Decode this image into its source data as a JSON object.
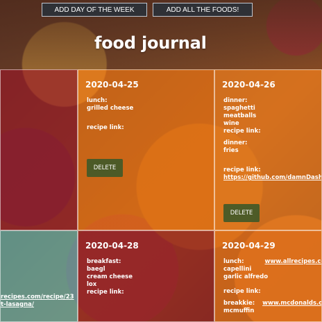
{
  "buttons": {
    "add_day": "ADD DAY OF THE WEEK",
    "add_foods": "ADD ALL THE FOODS!"
  },
  "page": {
    "title": "food journal"
  },
  "cards": {
    "left_top": {
      "links": []
    },
    "card_2020_04_25": {
      "date": "2020-04-25",
      "lines": [
        "lunch:",
        "grilled cheese",
        "recipe link:"
      ],
      "delete_label": "DELETE"
    },
    "card_2020_04_26": {
      "date": "2020-04-26",
      "lines": [
        "dinner:",
        "spaghetti",
        "meatballs",
        "wine",
        "recipe link:",
        "dinner:",
        "fries",
        "recipe link:"
      ],
      "link": "https://github.com/damnDasha",
      "delete_label": "DELETE"
    },
    "left_bottom": {
      "link_line_1": "recipes.com/recipe/23",
      "link_line_2": "t-lasagna/"
    },
    "card_2020_04_28": {
      "date": "2020-04-28",
      "lines": [
        "breakfast:",
        "baegl",
        "cream cheese",
        "lox",
        "recipe link:"
      ]
    },
    "card_2020_04_29": {
      "date": "2020-04-29",
      "lines": [
        "lunch:",
        "capellini",
        "garlic alfredo",
        "recipe link:",
        "breakkie:",
        "mcmuffin"
      ],
      "links": [
        "www.allrecipes.co",
        "www.mcdonalds.con"
      ]
    }
  },
  "colors": {
    "button_bg": "#2f3136",
    "button_border": "#bfc6cf",
    "text": "#ffffff"
  },
  "icons": {}
}
